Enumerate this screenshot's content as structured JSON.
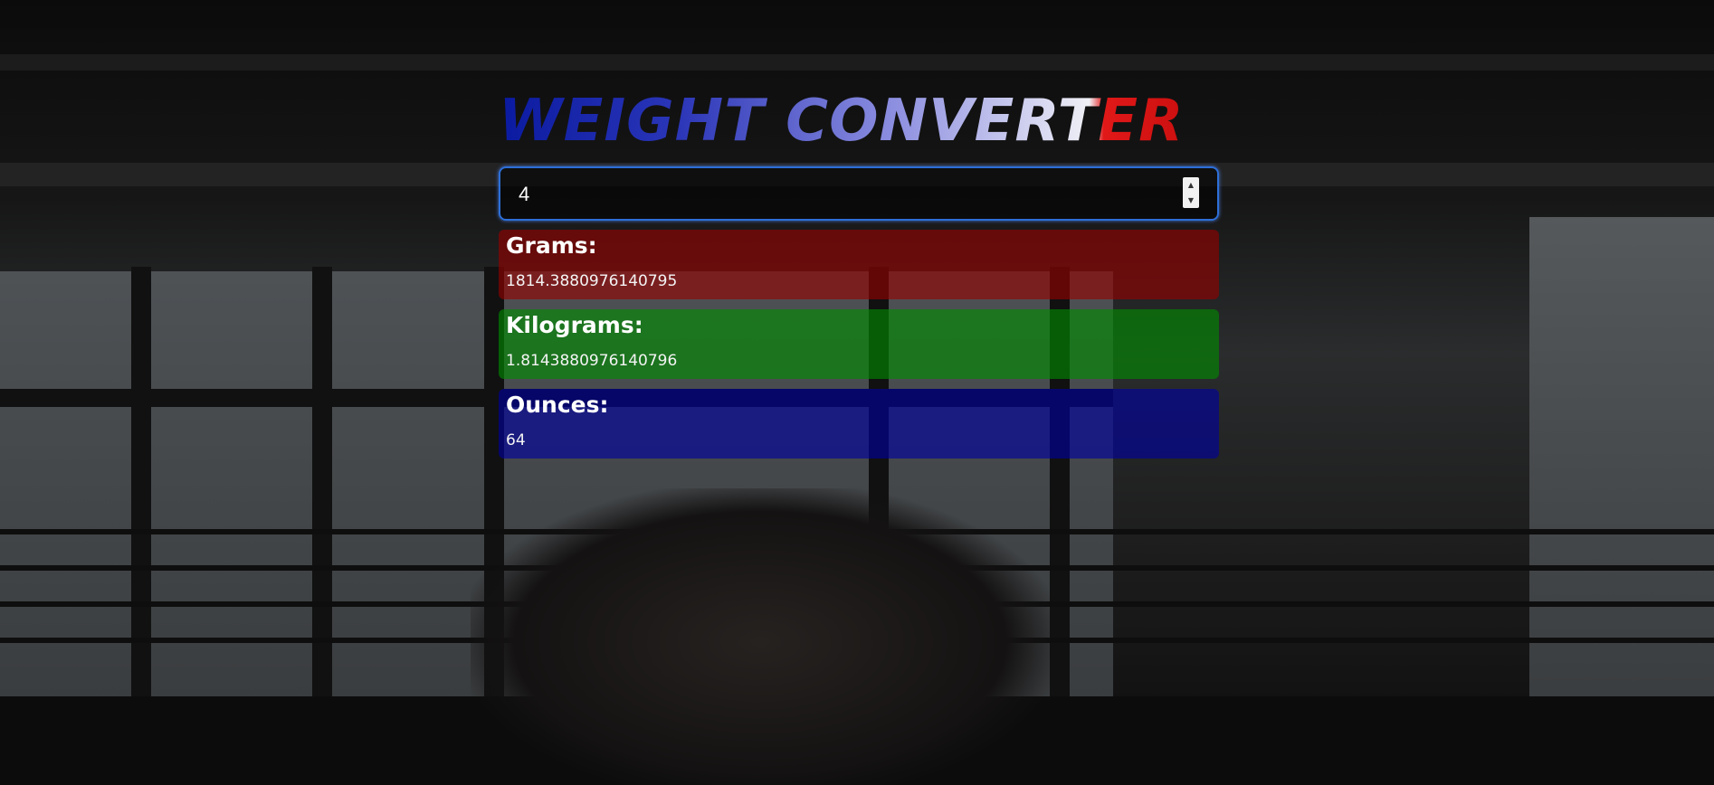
{
  "app": {
    "title": "WEIGHT CONVERTER"
  },
  "input": {
    "value": "4",
    "stepper_up": "▲",
    "stepper_down": "▼"
  },
  "results": [
    {
      "label": "Grams:",
      "value": "1814.3880976140795",
      "color": "#960000"
    },
    {
      "label": "Kilograms:",
      "value": "1.8143880976140796",
      "color": "#008c00"
    },
    {
      "label": "Ounces:",
      "value": "64",
      "color": "#0000a0"
    }
  ]
}
